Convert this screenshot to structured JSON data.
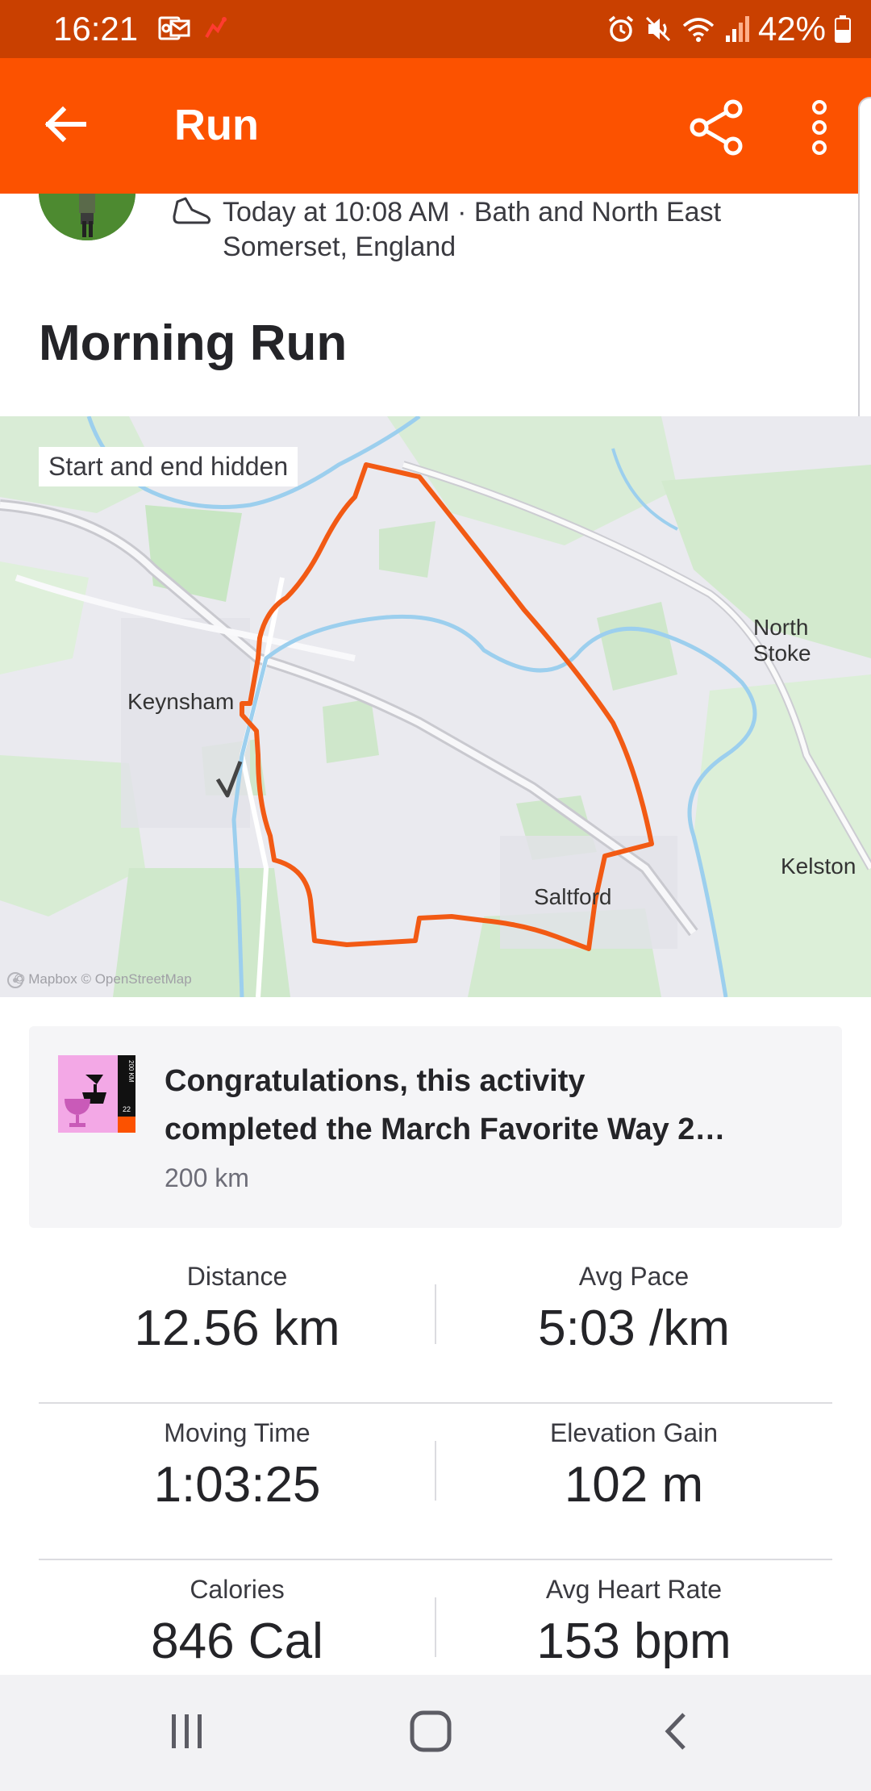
{
  "status_bar": {
    "time": "16:21",
    "battery": "42%",
    "icons": [
      "outlook-icon",
      "notification-icon",
      "alarm-icon",
      "mute-icon",
      "wifi-icon",
      "signal-icon",
      "battery-icon"
    ]
  },
  "app_bar": {
    "title": "Run",
    "back_icon": "arrow-left-icon",
    "share_icon": "share-icon",
    "more_icon": "more-vertical-icon",
    "color": "#fc5200"
  },
  "activity": {
    "meta": "Today at 10:08 AM · Bath and North East Somerset, England",
    "title": "Morning Run",
    "type_icon": "shoe-icon"
  },
  "map": {
    "privacy_badge": "Start and end hidden",
    "labels": {
      "keynsham": "Keynsham",
      "north_stoke": "North Stoke",
      "kelston": "Kelston",
      "saltford": "Saltford"
    },
    "attribution": "© Mapbox © OpenStreetMap",
    "route_color": "#f25a14"
  },
  "achievement": {
    "line1": "Congratulations, this activity",
    "line2": "completed the March Favorite Way 2…",
    "subtitle": "200 km",
    "badge_icon": "trophy-badge-icon",
    "badge_text": "200 KM",
    "badge_year": "22"
  },
  "stats": [
    {
      "left": {
        "label": "Distance",
        "value": "12.56 km"
      },
      "right": {
        "label": "Avg Pace",
        "value": "5:03 /km"
      }
    },
    {
      "left": {
        "label": "Moving Time",
        "value": "1:03:25"
      },
      "right": {
        "label": "Elevation Gain",
        "value": "102 m"
      }
    },
    {
      "left": {
        "label": "Calories",
        "value": "846 Cal"
      },
      "right": {
        "label": "Avg Heart Rate",
        "value": "153 bpm"
      }
    }
  ],
  "nav_bar": {
    "recents_icon": "recents-icon",
    "home_icon": "home-icon",
    "back_icon": "back-chevron-icon"
  }
}
